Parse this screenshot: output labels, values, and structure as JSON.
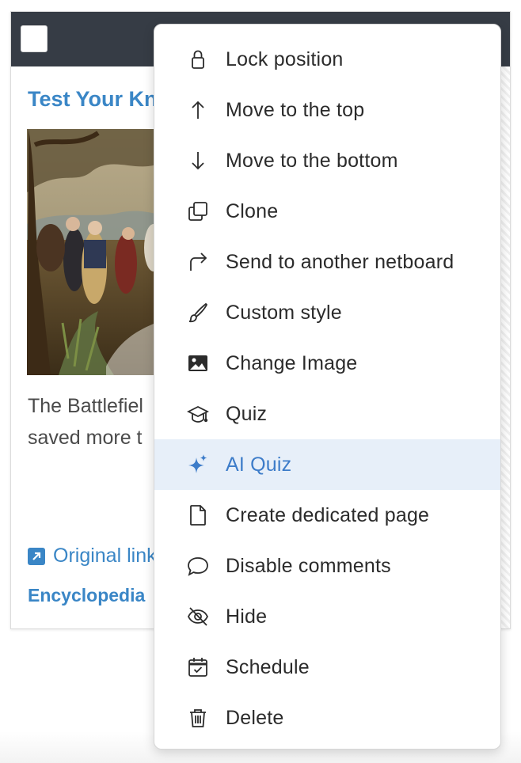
{
  "card": {
    "title": "Test Your Kn",
    "text_lines": [
      "The Battlefiel",
      "saved more t"
    ],
    "link_label": "Original link",
    "source": "Encyclopedia"
  },
  "menu": {
    "active_index": 8,
    "accent_color": "#3d7cc9",
    "items": [
      {
        "label": "Lock position",
        "icon": "lock-icon"
      },
      {
        "label": "Move to the top",
        "icon": "arrow-up-icon"
      },
      {
        "label": "Move to the bottom",
        "icon": "arrow-down-icon"
      },
      {
        "label": "Clone",
        "icon": "clone-icon"
      },
      {
        "label": "Send to another netboard",
        "icon": "share-arrow-icon"
      },
      {
        "label": "Custom style",
        "icon": "brush-icon"
      },
      {
        "label": "Change Image",
        "icon": "image-icon"
      },
      {
        "label": "Quiz",
        "icon": "graduation-cap-icon"
      },
      {
        "label": "AI Quiz",
        "icon": "sparkles-icon"
      },
      {
        "label": "Create dedicated page",
        "icon": "file-icon"
      },
      {
        "label": "Disable comments",
        "icon": "comment-icon"
      },
      {
        "label": "Hide",
        "icon": "eye-slash-icon"
      },
      {
        "label": "Schedule",
        "icon": "calendar-check-icon"
      },
      {
        "label": "Delete",
        "icon": "trash-icon"
      }
    ]
  }
}
